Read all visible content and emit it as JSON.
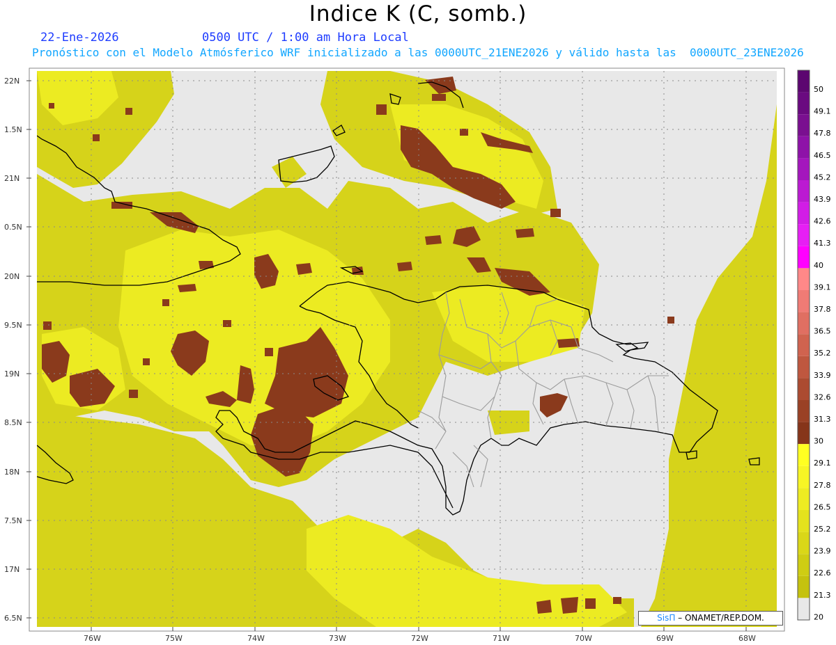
{
  "header": {
    "title": "Indice K (C, somb.)",
    "date": "22-Ene-2026",
    "valid_time": "0500 UTC / 1:00 am Hora Local",
    "model_info": "Pronóstico con el Modelo Atmósferico WRF inicializado a las 0000UTC_21ENE2026 y válido hasta las  0000UTC_23ENE2026"
  },
  "map": {
    "lat_labels": [
      "22N",
      "1.5N",
      "21N",
      "0.5N",
      "20N",
      "9.5N",
      "19N",
      "8.5N",
      "18N",
      "7.5N",
      "17N",
      "6.5N"
    ],
    "lon_labels": [
      "76W",
      "75W",
      "74W",
      "73W",
      "72W",
      "71W",
      "70W",
      "69W",
      "68W"
    ],
    "colors": {
      "background": "#e8e8e8",
      "shade_low": "#c8c10a",
      "shade_mid": "#dcd81b",
      "shade_high": "#f0f020",
      "above_30": "#8b3a1e",
      "coast": "#000000",
      "borders": "#9a9a9a"
    }
  },
  "colorbar": {
    "ticks": [
      "50",
      "49.1",
      "47.8",
      "46.5",
      "45.2",
      "43.9",
      "42.6",
      "41.3",
      "40",
      "39.1",
      "37.8",
      "36.5",
      "35.2",
      "33.9",
      "32.6",
      "31.3",
      "30",
      "29.1",
      "27.8",
      "26.5",
      "25.2",
      "23.9",
      "22.6",
      "21.3",
      "20"
    ],
    "colors": [
      "#5c0670",
      "#6a0a80",
      "#7a0f90",
      "#8e12a8",
      "#a416bd",
      "#bb1ad2",
      "#d21de6",
      "#e61ff4",
      "#ff00ff",
      "#ff8888",
      "#f07b75",
      "#e06f62",
      "#d0634f",
      "#bf573f",
      "#ac4b31",
      "#9a4125",
      "#86351a",
      "#ffff22",
      "#f7f525",
      "#eeec22",
      "#e4e21d",
      "#dad718",
      "#cfcd13",
      "#c5c20e",
      "#e8e8e8"
    ]
  },
  "credit": {
    "sis": "SisΠ",
    "text": " – ONAMET/REP.DOM."
  }
}
